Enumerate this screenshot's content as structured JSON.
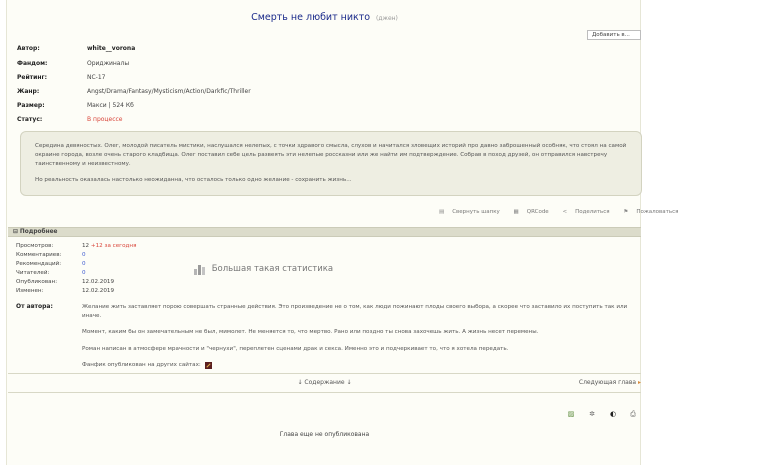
{
  "header": {
    "title": "Смерть не любит никто",
    "gen": "(джен)",
    "add_to_button": "Добавить в..."
  },
  "meta": [
    {
      "label": "Автор:",
      "value": "white__vorona",
      "kind": "author"
    },
    {
      "label": "Фандом:",
      "value": "Ориджиналы",
      "kind": "plain"
    },
    {
      "label": "Рейтинг:",
      "value": "NC-17",
      "kind": "plain"
    },
    {
      "label": "Жанр:",
      "value": "Angst/Drama/Fantasy/Mysticism/Action/Darkfic/Thriller",
      "kind": "plain"
    },
    {
      "label": "Размер:",
      "value": "Макси | 524 Кб",
      "kind": "plain"
    },
    {
      "label": "Статус:",
      "value": "В процессе",
      "kind": "status"
    }
  ],
  "summary": {
    "p1": "Середина девяностых. Олег, молодой писатель мистики, наслушался нелепых, с точки здравого смысла, слухов и начитался зловещих историй про давно заброшенный особняк, что стоял на самой окраине города, возле очень старого кладбища. Олег поставил себе цель развеять эти нелепые россказни или же найти им подтверждение. Собрав в поход друзей, он отправился навстречу таинственному и неизвестному.",
    "p2": "Но реальность оказалась настолько неожиданна, что осталось только одно желание - сохранить жизнь..."
  },
  "actions": {
    "collapse": "Свернуть шапку",
    "qr": "QRCode",
    "share": "Поделиться",
    "complain": "Пожаловаться"
  },
  "details": {
    "heading": "Подробнее",
    "stats": [
      {
        "label": "Просмотров:",
        "value": "12",
        "extra": "+12 за сегодня"
      },
      {
        "label": "Комментариев:",
        "value": "0"
      },
      {
        "label": "Рекомендаций:",
        "value": "0"
      },
      {
        "label": "Читателей:",
        "value": "0"
      },
      {
        "label": "Опубликован:",
        "value": "12.02.2019"
      },
      {
        "label": "Изменен:",
        "value": "12.02.2019"
      }
    ],
    "big_stats": "Большая такая статистика"
  },
  "author_notes": {
    "label": "От автора:",
    "p1": "Желание жить заставляет порою совершать странные действия. Это произведение не о том, как люди пожинают плоды своего выбора, а скорее что заставило их поступить так или иначе.",
    "p2": "Момент, каким бы он замечательным не был, мимолет. Не меняется то, что мертво. Рано или поздно ты снова захочешь жить. А жизнь несет перемены.",
    "p3": "Роман написан в атмосфере мрачности и \"чернухи\", переплетен сценами драк и секса. Именно это и подчеркивает то, что я хотела передать.",
    "p4": "Фанфик опубликован на других сайтах:"
  },
  "nav": {
    "contents": "↓ Содержание ↓",
    "next": "Следующая глава",
    "next_arrow": "▸"
  },
  "tools": [
    "font-icon",
    "settings-icon",
    "contrast-icon",
    "print-icon"
  ],
  "footer": {
    "not_published": "Глава еще не опубликована"
  },
  "colors": {
    "title": "#1a2a8a",
    "status": "#d9453a",
    "link": "#3d5ad1",
    "summary_bg": "#eeeee2",
    "section_bar": "#dcdccb"
  }
}
